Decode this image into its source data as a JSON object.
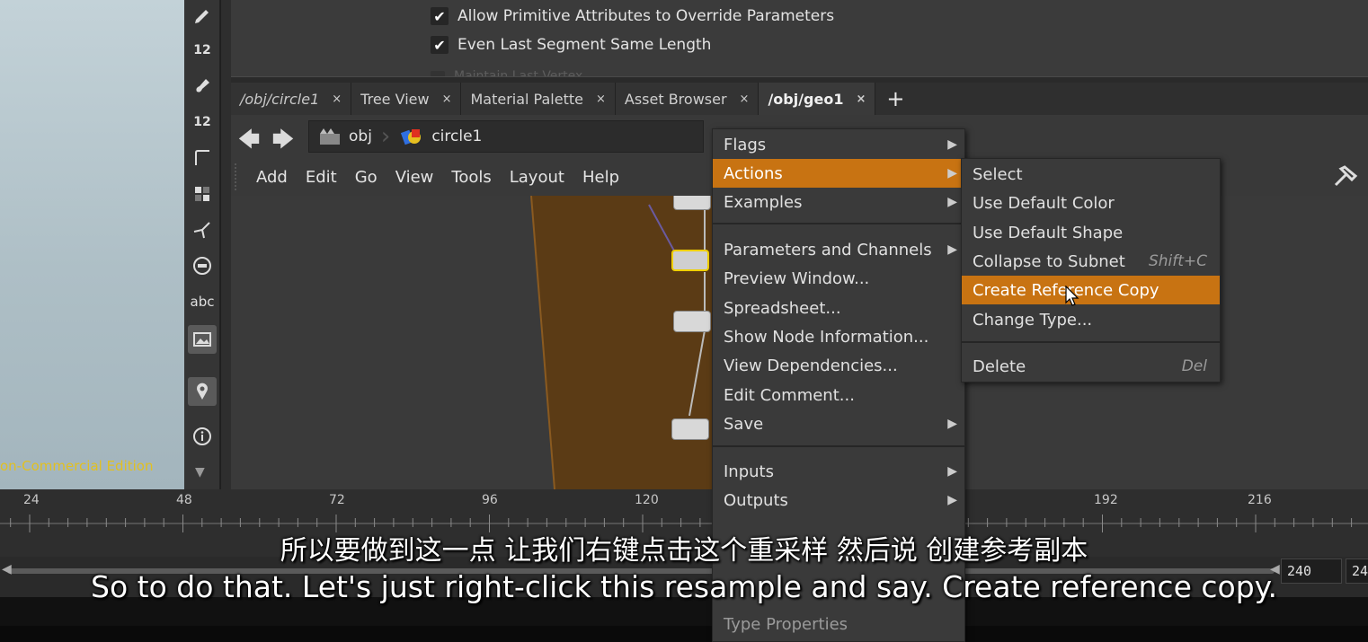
{
  "viewport": {
    "edition_text": "on-Commercial Edition"
  },
  "toolbar": {
    "icons": [
      "pen-icon",
      "resample-count-icon",
      "brush-icon",
      "layer-count-icon",
      "corner-icon",
      "grid-icon",
      "split-icon",
      "stop-icon",
      "text-icon",
      "image-icon",
      "pin-icon",
      "info-icon"
    ],
    "badge_12a": "12",
    "badge_12b": "12",
    "text_tool": "abc"
  },
  "params": {
    "rows": [
      {
        "label": "Allow Primitive Attributes to Override Parameters",
        "checked": true
      },
      {
        "label": "Even Last Segment Same Length",
        "checked": true
      },
      {
        "label": "Maintain Last Vertex",
        "checked": false
      }
    ]
  },
  "tabs": [
    {
      "label": "/obj/circle1",
      "close": "×"
    },
    {
      "label": "Tree View",
      "close": "×"
    },
    {
      "label": "Material Palette",
      "close": "×"
    },
    {
      "label": "Asset Browser",
      "close": "×"
    },
    {
      "label": "/obj/geo1",
      "close": "×"
    }
  ],
  "tab_add": "+",
  "pathbar": {
    "crumbs": [
      {
        "label": "obj"
      },
      {
        "label": "circle1"
      }
    ]
  },
  "menubar": {
    "items": [
      "Add",
      "Edit",
      "Go",
      "View",
      "Tools",
      "Layout",
      "Help"
    ]
  },
  "context_menu": {
    "items": [
      {
        "label": "Flags",
        "submenu": true
      },
      {
        "label": "Actions",
        "submenu": true,
        "highlighted": true
      },
      {
        "label": "Examples",
        "submenu": true
      },
      {
        "label": "Parameters and Channels",
        "submenu": true
      },
      {
        "label": "Preview Window...",
        "submenu": false
      },
      {
        "label": "Spreadsheet...",
        "submenu": false
      },
      {
        "label": "Show Node Information...",
        "submenu": false
      },
      {
        "label": "View Dependencies...",
        "submenu": false
      },
      {
        "label": "Edit Comment...",
        "submenu": false
      },
      {
        "label": "Save",
        "submenu": true
      },
      {
        "label": "Inputs",
        "submenu": true
      },
      {
        "label": "Outputs",
        "submenu": true
      },
      {
        "label": "Type Properties",
        "submenu": false
      }
    ]
  },
  "submenu": {
    "items": [
      {
        "label": "Select",
        "shortcut": ""
      },
      {
        "label": "Use Default Color",
        "shortcut": ""
      },
      {
        "label": "Use Default Shape",
        "shortcut": ""
      },
      {
        "label": "Collapse to Subnet",
        "shortcut": "Shift+C"
      },
      {
        "label": "Create Reference Copy",
        "shortcut": "",
        "highlighted": true
      },
      {
        "label": "Change Type...",
        "shortcut": ""
      },
      {
        "label": "Delete",
        "shortcut": "Del"
      }
    ]
  },
  "timeline": {
    "frames": [
      "24",
      "48",
      "72",
      "96",
      "120",
      "192",
      "216"
    ],
    "end_frame": "240",
    "end_frame_cut": "24"
  },
  "subtitles": {
    "chinese": "所以要做到这一点 让我们右键点击这个重采样 然后说 创建参考副本",
    "english": "So to do that. Let's just right-click this resample and say. Create reference copy."
  },
  "colors": {
    "highlight": "#c87312",
    "network_bg": "#5b3b15",
    "edition_text": "#e2c020"
  }
}
